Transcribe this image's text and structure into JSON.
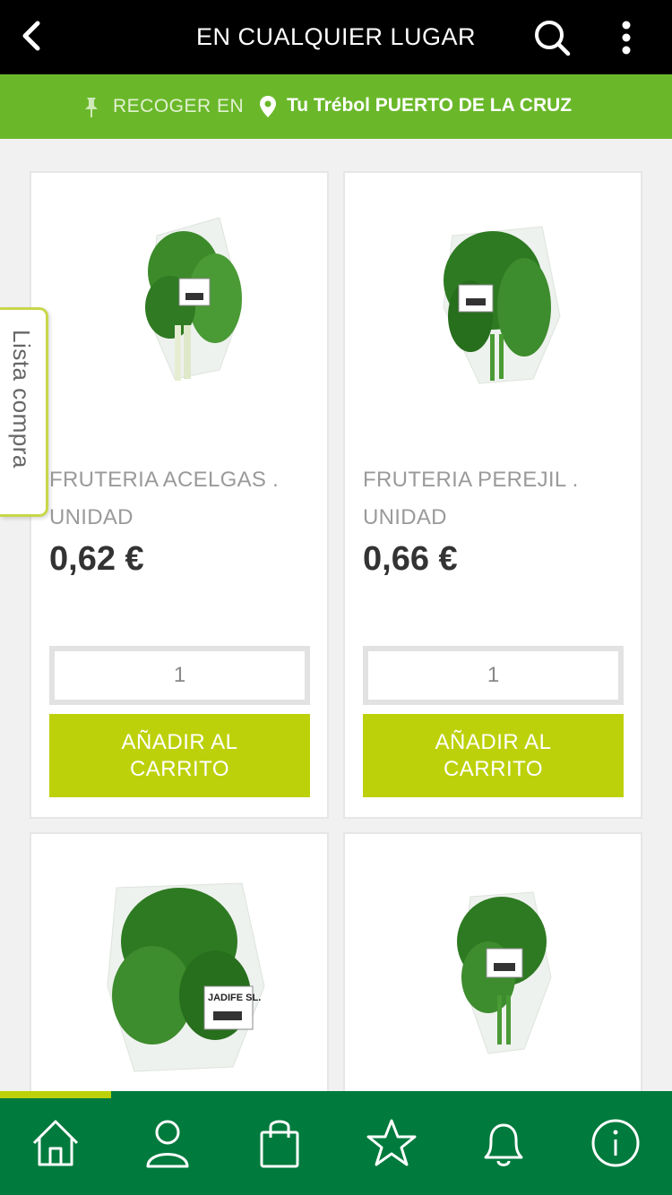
{
  "header": {
    "title": "EN CUALQUIER LUGAR",
    "back_icon": "chevron-left-icon",
    "search_icon": "search-icon",
    "more_icon": "more-vertical-icon"
  },
  "pickup": {
    "label": "RECOGER EN",
    "store": "Tu Trébol PUERTO DE LA CRUZ"
  },
  "side_tab": {
    "label": "Lista compra"
  },
  "products": [
    {
      "name": "FRUTERIA ACELGAS . UNIDAD",
      "price": "0,62 €",
      "quantity": "1",
      "add_label": "AÑADIR AL CARRITO"
    },
    {
      "name": "FRUTERIA PEREJIL . UNIDAD",
      "price": "0,66 €",
      "quantity": "1",
      "add_label": "AÑADIR AL CARRITO"
    },
    {
      "package_label": "JADIFE SL."
    },
    {}
  ],
  "bottom_nav": [
    "home-icon",
    "user-icon",
    "shopping-bag-icon",
    "star-icon",
    "bell-icon",
    "info-icon"
  ],
  "scroll_progress": 0.165,
  "colors": {
    "accent": "#bdd10a",
    "green": "#6ab82a",
    "dark_green": "#007a3d"
  }
}
